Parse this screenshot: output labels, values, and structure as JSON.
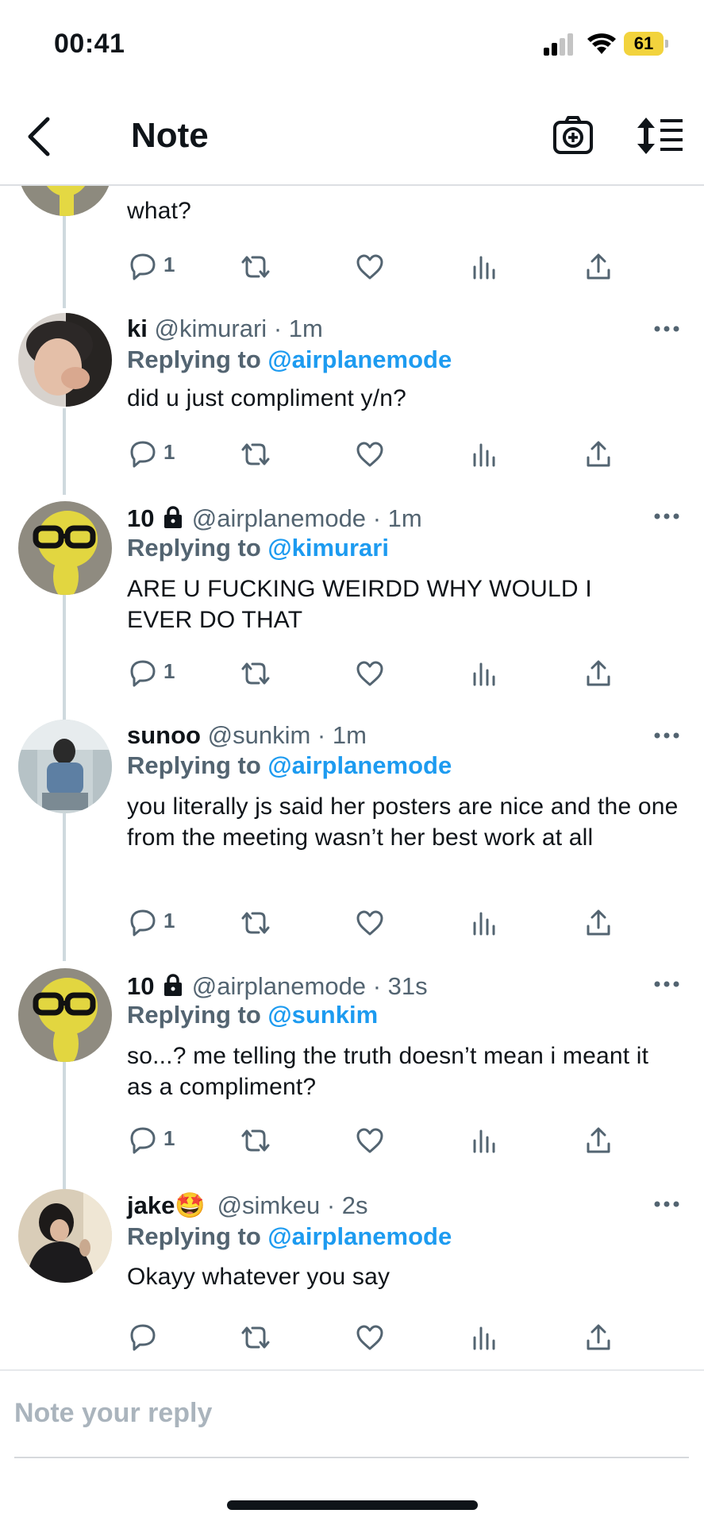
{
  "status_bar": {
    "time": "00:41",
    "battery": "61"
  },
  "header": {
    "title": "Note"
  },
  "partial_tweet": {
    "text": "what?",
    "reply_count": "1"
  },
  "tweets": [
    {
      "name": "ki",
      "handle": "@kimurari",
      "time": "· 1m",
      "replying_label": "Replying to",
      "replying_to": "@airplanemode",
      "text": "did u just compliment y/n?",
      "reply_count": "1"
    },
    {
      "name": "10",
      "handle": "@airplanemode",
      "time": "· 1m",
      "replying_label": "Replying to",
      "replying_to": "@kimurari",
      "text": "ARE U FUCKING WEIRDD WHY WOULD I EVER DO THAT",
      "reply_count": "1"
    },
    {
      "name": "sunoo",
      "handle": "@sunkim",
      "time": "· 1m",
      "replying_label": "Replying to",
      "replying_to": "@airplanemode",
      "text": "you literally js said her posters are nice and the one from the meeting wasn’t her best work at all",
      "reply_count": "1"
    },
    {
      "name": "10",
      "handle": "@airplanemode",
      "time": "· 31s",
      "replying_label": "Replying to",
      "replying_to": "@sunkim",
      "text": "so...? me telling the truth doesn’t mean i meant it as a compliment?",
      "reply_count": "1"
    },
    {
      "name": "jake🤩",
      "handle": "@simkeu",
      "time": "· 2s",
      "replying_label": "Replying to",
      "replying_to": "@airplanemode",
      "text": "Okayy whatever you say",
      "reply_count": ""
    }
  ],
  "composer": {
    "placeholder": "Note your reply"
  },
  "icons": [
    "chevron-left-icon",
    "camera-plus-icon",
    "sort-icon",
    "reply-icon",
    "retweet-icon",
    "like-icon",
    "stats-icon",
    "share-icon",
    "more-icon",
    "lock-icon"
  ],
  "colors": {
    "accent": "#1d9bf0",
    "secondary_text": "#536471",
    "battery": "#f2d33d"
  }
}
